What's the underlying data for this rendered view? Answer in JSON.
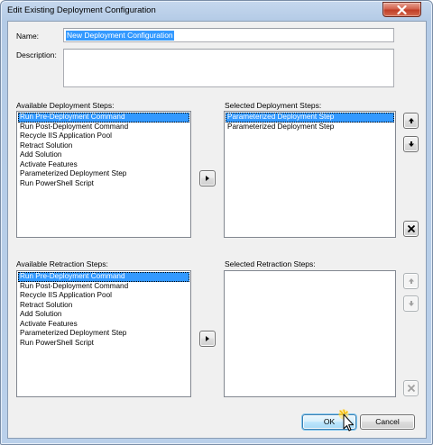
{
  "window": {
    "title": "Edit Existing Deployment Configuration"
  },
  "form": {
    "name_label": "Name:",
    "name_value": "New Deployment Configuration",
    "description_label": "Description:",
    "description_value": ""
  },
  "deployment": {
    "available_label": "Available Deployment Steps:",
    "available_items": [
      "Run Pre-Deployment Command",
      "Run Post-Deployment Command",
      "Recycle IIS Application Pool",
      "Retract Solution",
      "Add Solution",
      "Activate Features",
      "Parameterized Deployment Step",
      "Run PowerShell Script"
    ],
    "selected_label": "Selected Deployment Steps:",
    "selected_items": [
      "Parameterized Deployment Step",
      "Parameterized Deployment Step"
    ]
  },
  "retraction": {
    "available_label": "Available Retraction Steps:",
    "available_items": [
      "Run Pre-Deployment Command",
      "Run Post-Deployment Command",
      "Recycle IIS Application Pool",
      "Retract Solution",
      "Add Solution",
      "Activate Features",
      "Parameterized Deployment Step",
      "Run PowerShell Script"
    ],
    "selected_label": "Selected Retraction Steps:",
    "selected_items": []
  },
  "buttons": {
    "ok": "OK",
    "cancel": "Cancel"
  },
  "icons": {
    "close": "close-icon",
    "add": "arrow-right-icon",
    "move_up": "arrow-up-icon",
    "move_down": "arrow-down-icon",
    "remove": "x-remove-icon",
    "cursor": "mouse-pointer-icon"
  },
  "colors": {
    "selection": "#3399ff",
    "close_button": "#c9452d",
    "client_background": "#f0f0f0",
    "frame": "#b9cfea"
  }
}
